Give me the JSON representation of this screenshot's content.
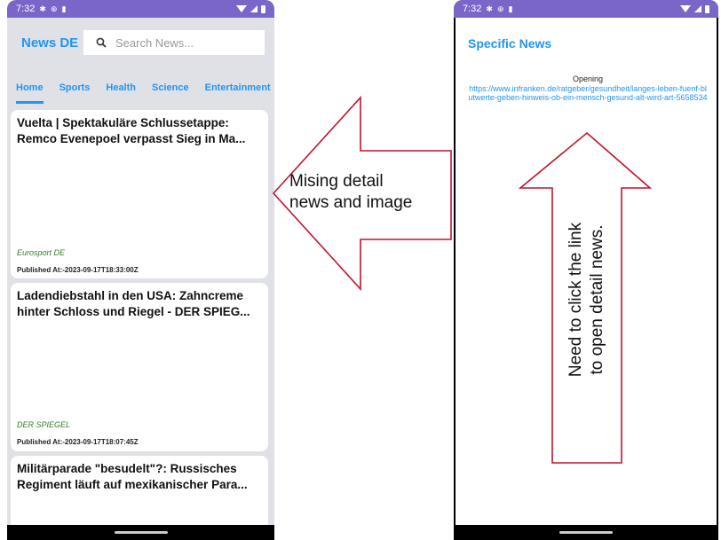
{
  "left_phone": {
    "status_time": "7:32",
    "app_title": "News DE",
    "search_placeholder": "Search News...",
    "tabs": [
      {
        "label": "Home",
        "active": true
      },
      {
        "label": "Sports",
        "active": false
      },
      {
        "label": "Health",
        "active": false
      },
      {
        "label": "Science",
        "active": false
      },
      {
        "label": "Entertainment",
        "active": false
      }
    ],
    "articles": [
      {
        "title": "Vuelta | Spektakuläre Schlussetappe: Remco Evenepoel verpasst Sieg in Ma...",
        "source": "Eurosport DE",
        "published": "Published At:-2023-09-17T18:33:00Z"
      },
      {
        "title": "Ladendiebstahl in den USA: Zahncreme hinter Schloss und Riegel - DER SPIEG...",
        "source": "DER SPIEGEL",
        "published": "Published At:-2023-09-17T18:07:45Z"
      },
      {
        "title": "Militärparade \"besudelt\"?: Russisches Regiment läuft auf mexikanischer Para..."
      }
    ]
  },
  "right_phone": {
    "status_time": "7:32",
    "title": "Specific News",
    "opening_label": "Opening",
    "opening_url": "https://www.infranken.de/ratgeber/gesundheit/langes-leben-fuenf-blutwerte-geben-hinweis-ob-ein-mensch-gesund-alt-wird-art-5658534"
  },
  "annotations": {
    "left_note_line1": "Mising detail",
    "left_note_line2": "news and image",
    "right_note_line1": "Need to click the link",
    "right_note_line2": "to open detail news.",
    "arrow_color": "#c0142c"
  },
  "colors": {
    "status_bar": "#7a66c9",
    "accent": "#2195f3",
    "source_green": "#3a7d2b",
    "app_background": "#dfe1e6"
  }
}
